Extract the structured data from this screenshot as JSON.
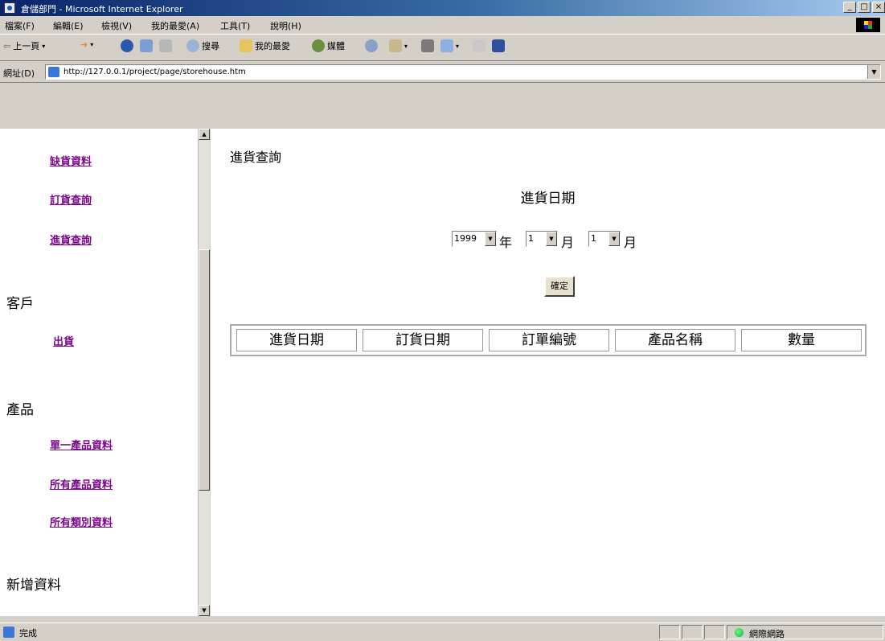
{
  "window": {
    "title": "倉儲部門 - Microsoft Internet Explorer",
    "controls": [
      "_",
      "□",
      "×"
    ]
  },
  "menu": [
    "檔案(F)",
    "編輯(E)",
    "檢視(V)",
    "我的最愛(A)",
    "工具(T)",
    "說明(H)"
  ],
  "toolbar": {
    "back": "上一頁",
    "search": "搜尋",
    "favorites": "我的最愛",
    "media": "媒體"
  },
  "address": {
    "label": "網址(D)",
    "url": "http://127.0.0.1/project/page/storehouse.htm"
  },
  "sidebar": {
    "links_top": [
      "缺貨資料",
      "訂貨查詢",
      "進貨查詢"
    ],
    "customer_heading": "客戶",
    "customer_links": [
      "出貨"
    ],
    "product_heading": "產品",
    "product_links": [
      "單一產品資料",
      "所有產品資料",
      "所有類別資料"
    ],
    "add_heading": "新增資料"
  },
  "main": {
    "page_title": "進貨查詢",
    "date_label": "進貨日期",
    "year": "1999",
    "year_unit": "年",
    "month": "1",
    "month_unit": "月",
    "day": "1",
    "day_unit": "月",
    "confirm": "確定",
    "columns": [
      "進貨日期",
      "訂貨日期",
      "訂單編號",
      "產品名稱",
      "數量"
    ]
  },
  "status": {
    "text": "完成",
    "zone": "網際網路"
  }
}
